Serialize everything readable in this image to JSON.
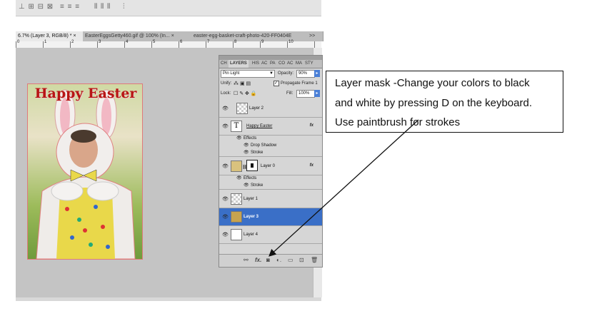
{
  "toolbar": {},
  "tabs": [
    {
      "label": "6.7% (Layer 3, RGB/8) *",
      "close": "×"
    },
    {
      "label": "EasterEggsGetty460.gif @ 100% (In...",
      "close": "×"
    },
    {
      "label": "easter-egg-basket-craft-photo-420-FF0404E",
      "close": ""
    },
    {
      "label": ">>",
      "close": ""
    }
  ],
  "ruler": [
    "0",
    "1",
    "2",
    "3",
    "4",
    "5",
    "6",
    "7",
    "8",
    "9",
    "10"
  ],
  "image": {
    "banner_text": "Happy Easter"
  },
  "layers_panel": {
    "tabs": [
      "CH",
      "LAYERS",
      "HIS",
      "AC",
      "PA",
      "CO",
      "AC",
      "MA",
      "STY"
    ],
    "blend_mode": "Pin Light",
    "opacity_label": "Opacity:",
    "opacity_value": "90%",
    "unify_label": "Unify:",
    "propagate_label": "Propagate Frame 1",
    "lock_label": "Lock:",
    "fill_label": "Fill:",
    "fill_value": "100%",
    "layers": [
      {
        "name": "Layer 2"
      },
      {
        "name": "Happy Easter",
        "type_glyph": "T",
        "fx": "fx"
      },
      {
        "name": "Layer 0",
        "fx": "fx"
      },
      {
        "name": "Layer 1"
      },
      {
        "name": "Layer 3"
      },
      {
        "name": "Layer 4"
      }
    ],
    "effects": {
      "effects_label": "Effects",
      "drop_shadow": "Drop Shadow",
      "stroke": "Stroke",
      "effects_label_2": "Effects",
      "stroke_2": "Stroke"
    },
    "footer_icons": [
      "link-icon",
      "fx-icon",
      "mask-icon",
      "adjustment-icon",
      "folder-icon",
      "new-layer-icon",
      "trash-icon"
    ]
  },
  "callout": {
    "line1": "Layer mask -Change your colors to black",
    "line2": "and white by pressing D on the keyboard.",
    "line3": "Use paintbrush for strokes"
  },
  "colors": {
    "selected_layer": "#3a6fc7",
    "panel_bg": "#d6d6d6",
    "canvas_bg": "#c4c4c4"
  }
}
